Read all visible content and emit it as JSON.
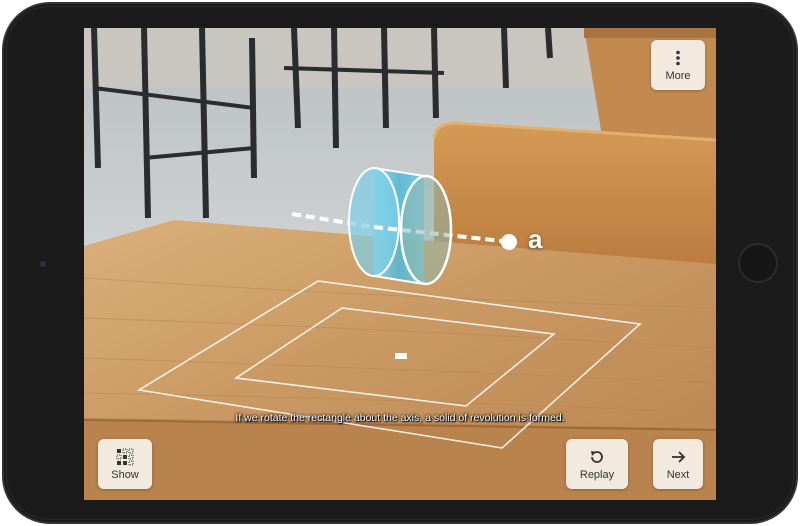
{
  "scene": {
    "axis_label": "a",
    "caption": "If we rotate the rectangle about the axis, a solid of revolution is formed."
  },
  "toolbar": {
    "more": {
      "label": "More",
      "icon": "vertical-dots-icon"
    },
    "show": {
      "label": "Show",
      "icon": "grid-icon"
    },
    "replay": {
      "label": "Replay",
      "icon": "replay-icon"
    },
    "next": {
      "label": "Next",
      "icon": "arrow-right-icon"
    }
  },
  "colors": {
    "cylinder": "#5ec2e0",
    "table": "#c89660",
    "bezel": "#1b1b1b"
  }
}
